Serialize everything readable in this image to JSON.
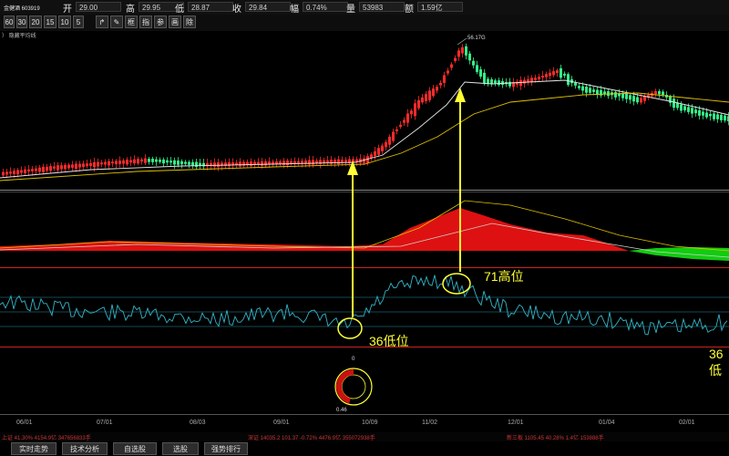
{
  "quote": {
    "stock": "金健酒 603919",
    "open_label": "开",
    "open_value": "29.00",
    "high_label": "高",
    "high_value": "29.95",
    "low_label": "低",
    "low_value": "28.87",
    "close_label": "收",
    "close_value": "29.84",
    "change_label": "幅",
    "change_value": "0.74%",
    "volume_label": "量",
    "volume_value": "53983",
    "amount_label": "额",
    "amount_value": "1.59亿"
  },
  "toolbar": {
    "periods": [
      "60",
      "30",
      "20",
      "15",
      "10",
      "5"
    ],
    "tools": [
      "↱",
      "✎",
      "框",
      "指",
      "参",
      "画",
      "除"
    ]
  },
  "chart_label": "） 隐藏平均线",
  "price_annotation": "56.17G",
  "annotations": {
    "low": "36低位",
    "high": "71高位",
    "right": "36低"
  },
  "gauge_top_label": "0",
  "gauge_bottom_label": "0.46",
  "dates": [
    "06/01",
    "07/01",
    "08/03",
    "09/01",
    "10/09",
    "11/02",
    "12/01",
    "01/04",
    "02/01"
  ],
  "status_bar": {
    "left": "上证 41.30%  4154.9亿  347656833手",
    "middle": "深证 14035.2  101.37  -0.72%  4476.9亿  355072938手",
    "right": "新三板 1105.45  40.28%  1.4亿  153888手"
  },
  "bottom_tabs": [
    "实时走势",
    "技术分析",
    "自选股",
    "选股",
    "强势排行"
  ],
  "colors": {
    "up": "#ff2a2a",
    "down": "#33ee88",
    "ma_fast": "#e6e6e6",
    "ma_slow": "#e0c000",
    "macd_pos": "#dd1111",
    "macd_neg": "#11cc11",
    "rsi": "#34b4c8",
    "annotation": "#ffff33"
  }
}
